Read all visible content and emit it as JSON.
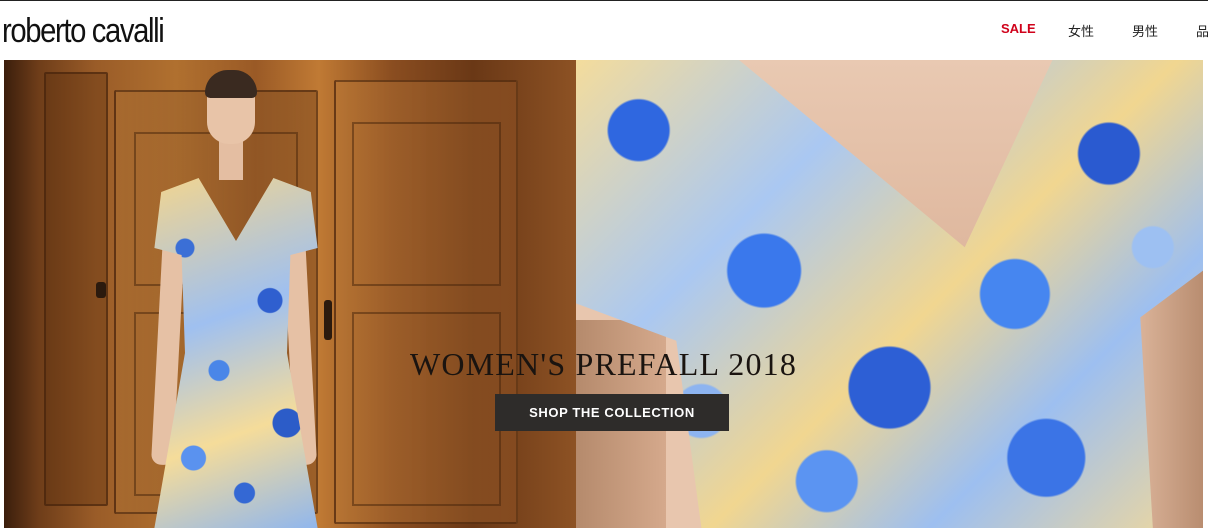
{
  "header": {
    "logo": "roberto cavalli",
    "nav": {
      "sale": "SALE",
      "women": "女性",
      "men": "男性",
      "brand": "品"
    }
  },
  "hero": {
    "headline": "WOMEN'S PREFALL 2018",
    "cta_label": "SHOP THE COLLECTION"
  },
  "colors": {
    "sale_accent": "#d0021b",
    "cta_background": "#2e2c2a",
    "cta_text": "#ffffff"
  }
}
